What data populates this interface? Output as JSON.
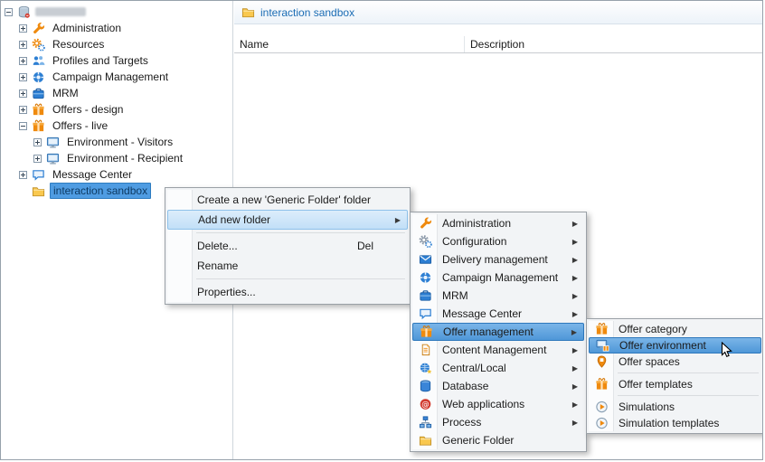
{
  "tree": {
    "items": [
      {
        "label": "",
        "icon": "database",
        "redacted": true
      },
      {
        "label": "Administration",
        "icon": "wrench"
      },
      {
        "label": "Resources",
        "icon": "gears"
      },
      {
        "label": "Profiles and Targets",
        "icon": "people"
      },
      {
        "label": "Campaign Management",
        "icon": "campaign"
      },
      {
        "label": "MRM",
        "icon": "mrm"
      },
      {
        "label": "Offers - design",
        "icon": "gift"
      },
      {
        "label": "Offers - live",
        "icon": "gift"
      },
      {
        "label": "Environment - Visitors",
        "icon": "monitor"
      },
      {
        "label": "Environment - Recipient",
        "icon": "monitor"
      },
      {
        "label": "Message Center",
        "icon": "bubble"
      },
      {
        "label": "interaction sandbox",
        "icon": "folder",
        "selected": true
      }
    ]
  },
  "content": {
    "header_title": "interaction sandbox",
    "columns": [
      "Name",
      "Description"
    ]
  },
  "context_menu": {
    "items": [
      {
        "label": "Create a new 'Generic Folder' folder"
      },
      {
        "label": "Add new folder",
        "submenu": true,
        "highlighted": true
      },
      {
        "separator": true
      },
      {
        "label": "Delete...",
        "shortcut": "Del"
      },
      {
        "label": "Rename"
      },
      {
        "separator": true
      },
      {
        "label": "Properties..."
      }
    ]
  },
  "folder_type_menu": {
    "items": [
      {
        "label": "Administration",
        "icon": "wrench",
        "submenu": true
      },
      {
        "label": "Configuration",
        "icon": "gears-gray",
        "submenu": true
      },
      {
        "label": "Delivery management",
        "icon": "envelope",
        "submenu": true
      },
      {
        "label": "Campaign Management",
        "icon": "campaign",
        "submenu": true
      },
      {
        "label": "MRM",
        "icon": "mrm",
        "submenu": true
      },
      {
        "label": "Message Center",
        "icon": "bubble",
        "submenu": true
      },
      {
        "label": "Offer management",
        "icon": "gift",
        "submenu": true,
        "highlighted": true
      },
      {
        "label": "Content Management",
        "icon": "content",
        "submenu": true
      },
      {
        "label": "Central/Local",
        "icon": "central",
        "submenu": true
      },
      {
        "label": "Database",
        "icon": "database-blue",
        "submenu": true
      },
      {
        "label": "Web applications",
        "icon": "webapp",
        "submenu": true
      },
      {
        "label": "Process",
        "icon": "process",
        "submenu": true
      },
      {
        "label": "Generic Folder",
        "icon": "folder"
      }
    ]
  },
  "offer_menu": {
    "items": [
      {
        "label": "Offer category",
        "icon": "gift"
      },
      {
        "label": "Offer environment",
        "icon": "offer-environment",
        "highlighted": true
      },
      {
        "label": "Offer spaces",
        "icon": "pin"
      },
      {
        "separator": true
      },
      {
        "label": "Offer templates",
        "icon": "gift"
      },
      {
        "separator": true
      },
      {
        "label": "Simulations",
        "icon": "play"
      },
      {
        "label": "Simulation templates",
        "icon": "play"
      }
    ]
  },
  "colors": {
    "selection_blue": "#4f9ce2",
    "menu_highlight_light": "#c2dff7",
    "menu_highlight_strong": "#4f97d8",
    "accent_orange": "#ef8a0e",
    "accent_blue": "#2d7fd3"
  }
}
